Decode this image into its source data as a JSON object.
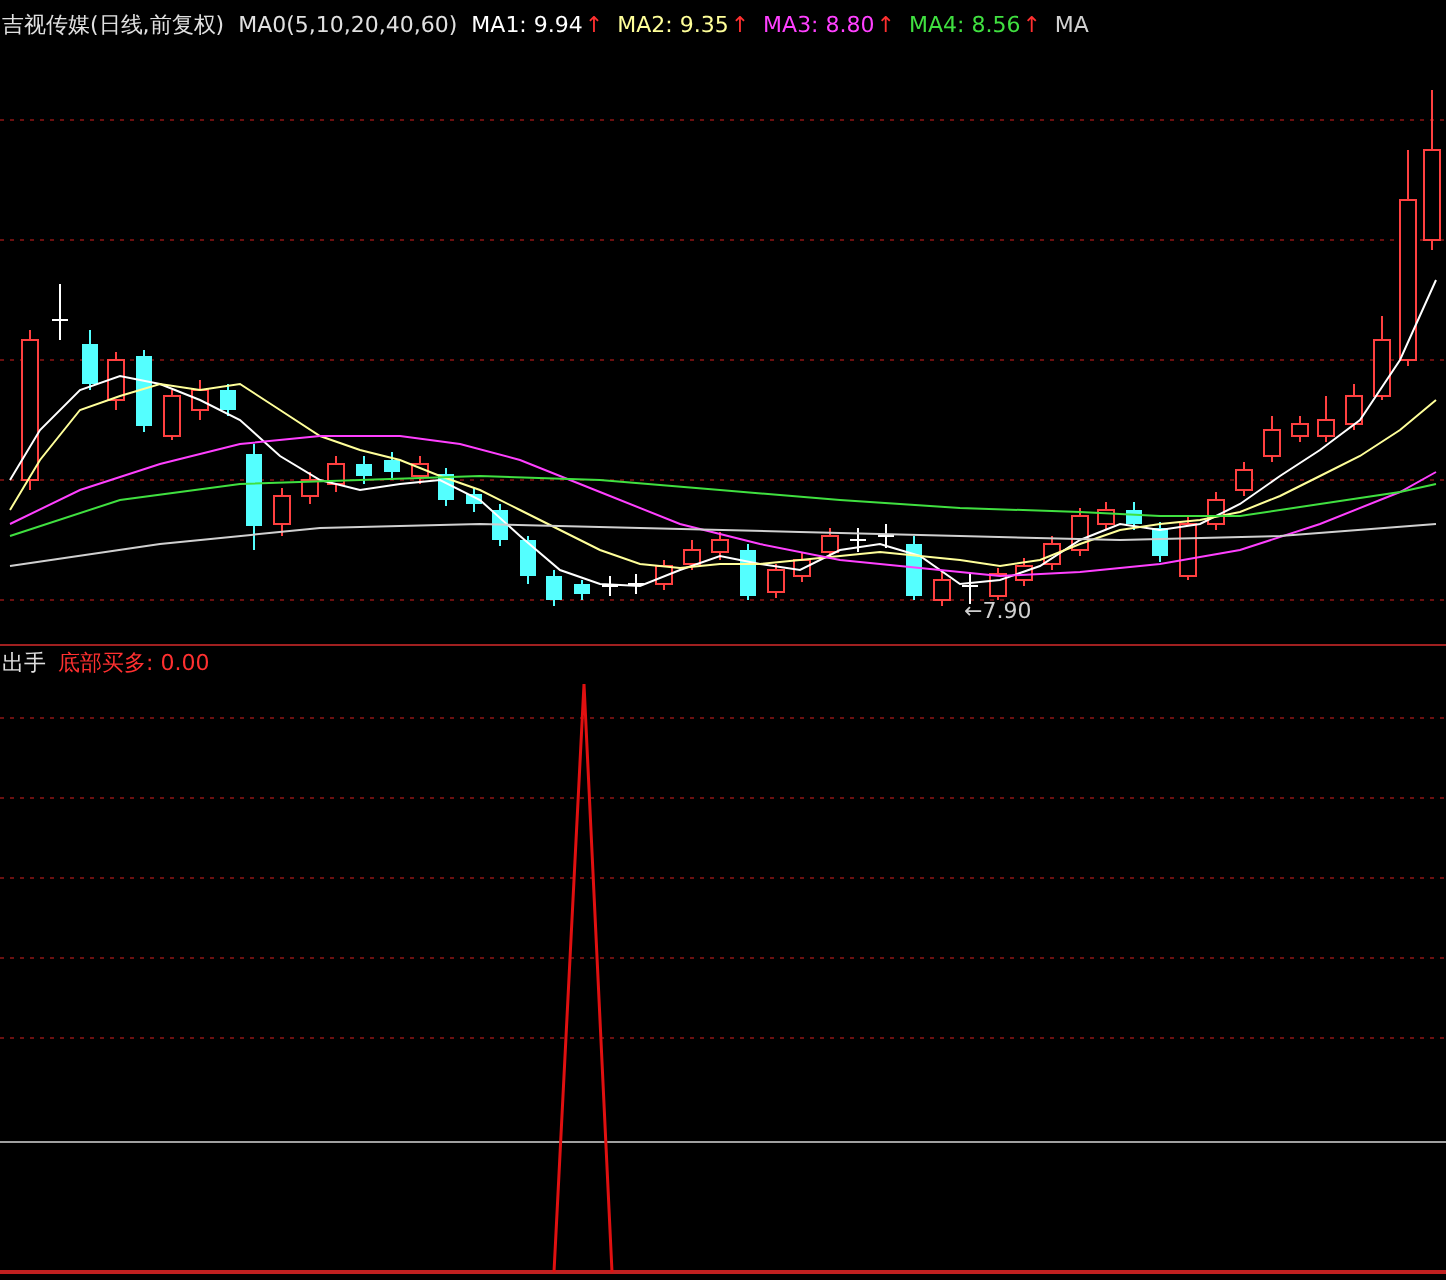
{
  "header": {
    "title": "吉视传媒(日线,前复权)",
    "parameters": "MA0(5,10,20,40,60)",
    "averages": [
      {
        "label": "MA1: 9.94",
        "arrow": "↑",
        "color": "#ffffff"
      },
      {
        "label": "MA2: 9.35",
        "arrow": "↑",
        "color": "#ffff99"
      },
      {
        "label": "MA3: 8.80",
        "arrow": "↑",
        "color": "#ff40ff"
      },
      {
        "label": "MA4: 8.56",
        "arrow": "↑",
        "color": "#40e040"
      },
      {
        "label": "MA",
        "color": "#d0d0d0"
      }
    ]
  },
  "main_chart": {
    "low_label": "←7.90"
  },
  "indicator": {
    "name": "出手",
    "reading": "底部买多: 0.00"
  }
}
